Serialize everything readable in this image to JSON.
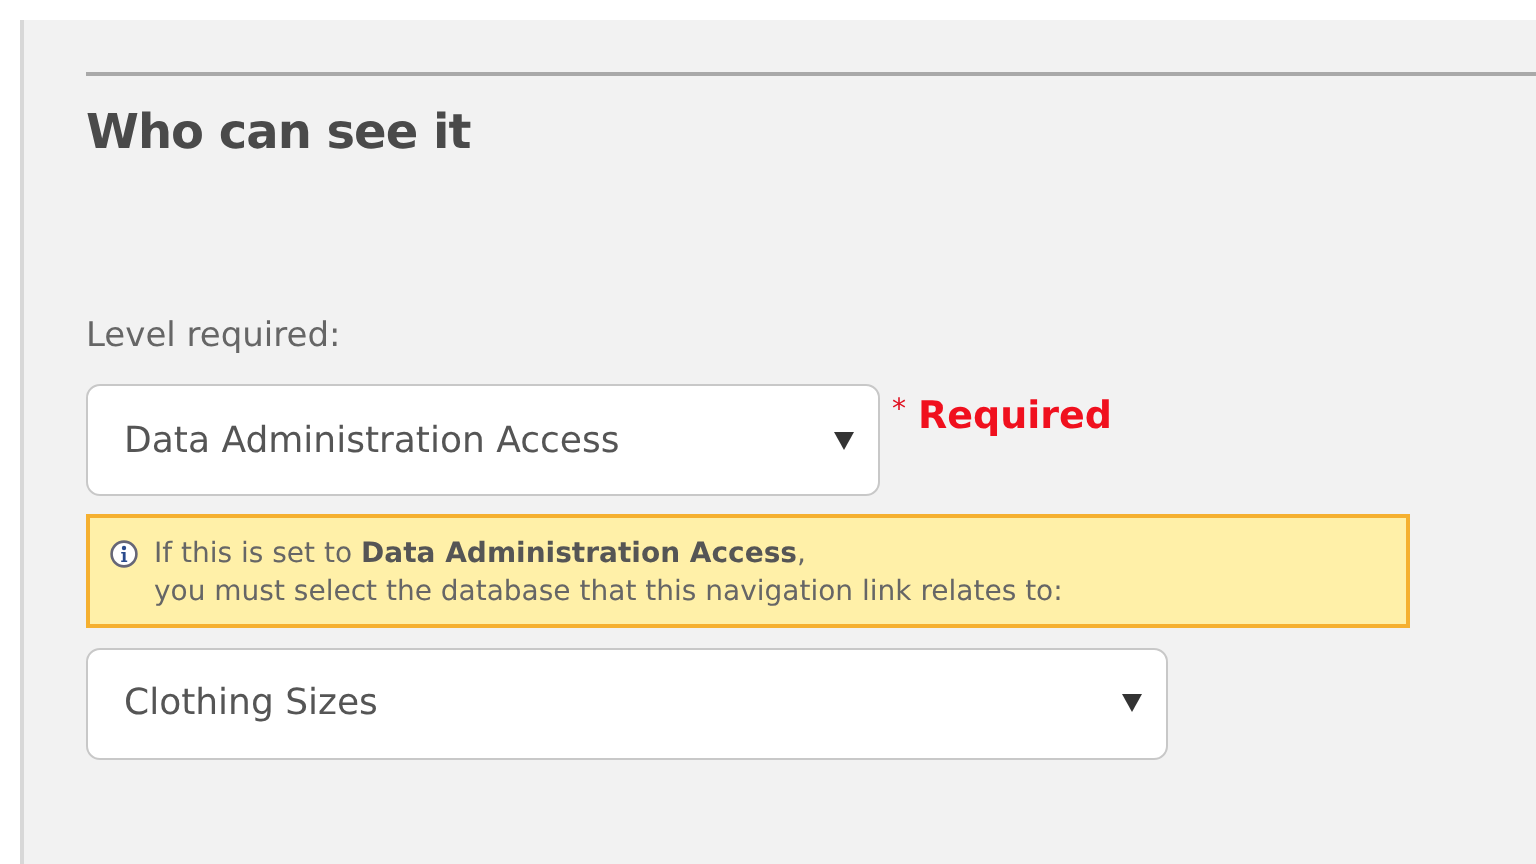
{
  "section": {
    "title": "Who can see it"
  },
  "level_field": {
    "label": "Level required:",
    "value": "Data Administration Access",
    "required_mark": "*",
    "required_text": "Required"
  },
  "notice": {
    "line_1": "If this is set to **Data Administration Access**,",
    "line_2": "you must select the database that this navigation link relates to:"
  },
  "database_field": {
    "value": "Clothing Sizes"
  }
}
